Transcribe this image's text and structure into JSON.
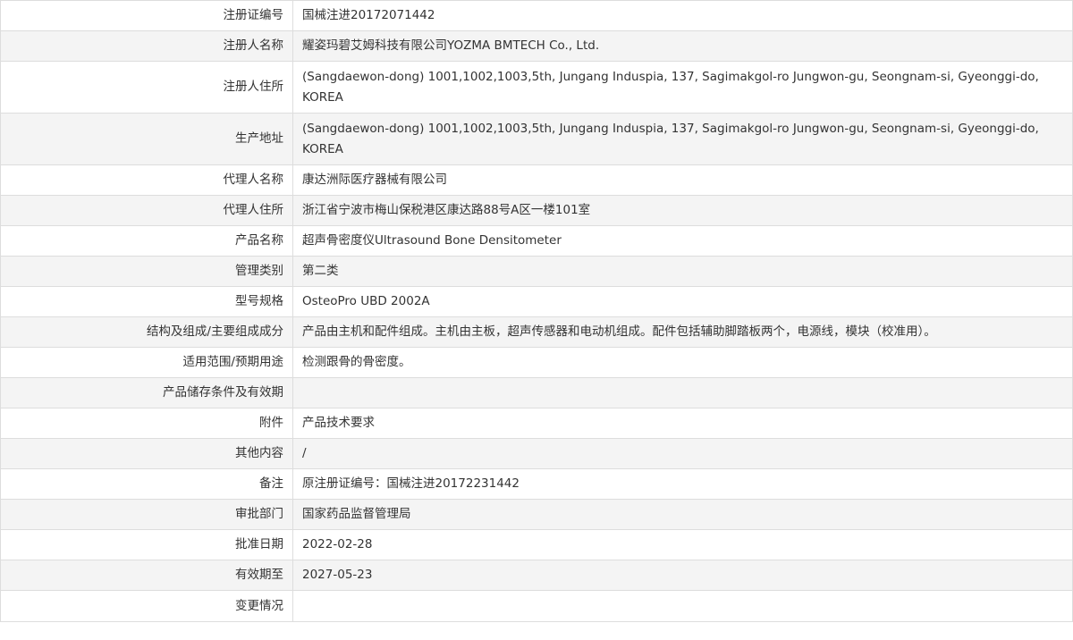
{
  "rows": [
    {
      "label": "注册证编号",
      "value": "国械注进20172071442"
    },
    {
      "label": "注册人名称",
      "value": "耀姿玛碧艾姆科技有限公司YOZMA BMTECH Co., Ltd."
    },
    {
      "label": "注册人住所",
      "value": "(Sangdaewon-dong) 1001,1002,1003,5th, Jungang Induspia, 137, Sagimakgol-ro Jungwon-gu, Seongnam-si, Gyeonggi-do, KOREA"
    },
    {
      "label": "生产地址",
      "value": "(Sangdaewon-dong) 1001,1002,1003,5th, Jungang Induspia, 137, Sagimakgol-ro Jungwon-gu, Seongnam-si, Gyeonggi-do, KOREA"
    },
    {
      "label": "代理人名称",
      "value": "康达洲际医疗器械有限公司"
    },
    {
      "label": "代理人住所",
      "value": "浙江省宁波市梅山保税港区康达路88号A区一楼101室"
    },
    {
      "label": "产品名称",
      "value": "超声骨密度仪Ultrasound Bone Densitometer"
    },
    {
      "label": "管理类别",
      "value": "第二类"
    },
    {
      "label": "型号规格",
      "value": "OsteoPro UBD 2002A"
    },
    {
      "label": "结构及组成/主要组成成分",
      "value": "产品由主机和配件组成。主机由主板，超声传感器和电动机组成。配件包括辅助脚踏板两个，电源线，模块（校准用）。"
    },
    {
      "label": "适用范围/预期用途",
      "value": "检测跟骨的骨密度。"
    },
    {
      "label": "产品储存条件及有效期",
      "value": ""
    },
    {
      "label": "附件",
      "value": "产品技术要求"
    },
    {
      "label": "其他内容",
      "value": "/"
    },
    {
      "label": "备注",
      "value": "原注册证编号：国械注进20172231442"
    },
    {
      "label": "审批部门",
      "value": "国家药品监督管理局"
    },
    {
      "label": "批准日期",
      "value": "2022-02-28"
    },
    {
      "label": "有效期至",
      "value": "2027-05-23"
    },
    {
      "label": "变更情况",
      "value": ""
    }
  ]
}
